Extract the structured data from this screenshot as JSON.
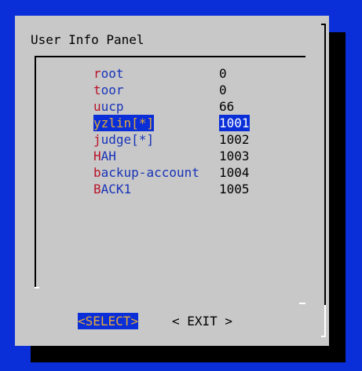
{
  "panel": {
    "title": "User Info Panel"
  },
  "users": [
    {
      "hotkey": "r",
      "rest": "oot",
      "uid": "0",
      "selected": false
    },
    {
      "hotkey": "t",
      "rest": "oor",
      "uid": "0",
      "selected": false
    },
    {
      "hotkey": "u",
      "rest": "ucp",
      "uid": "66",
      "selected": false
    },
    {
      "hotkey": "y",
      "rest": "zlin[*]",
      "uid": "1001",
      "selected": true
    },
    {
      "hotkey": "j",
      "rest": "udge[*]",
      "uid": "1002",
      "selected": false
    },
    {
      "hotkey": "H",
      "rest": "AH",
      "uid": "1003",
      "selected": false
    },
    {
      "hotkey": "b",
      "rest": "ackup-account",
      "uid": "1004",
      "selected": false
    },
    {
      "hotkey": "B",
      "rest": "ACK1",
      "uid": "1005",
      "selected": false
    }
  ],
  "buttons": {
    "select_label": "<SELECT>",
    "exit_label": "< EXIT >"
  },
  "colors": {
    "screen_background": "#0a2fd8",
    "dialog_background": "#c8c8c8",
    "shadow": "#000000",
    "item_text": "#1833b8",
    "hotkey": "#b8142a",
    "highlight_background": "#0a2fd8",
    "highlight_text": "#e4a93a",
    "highlight_value": "#ffffff"
  }
}
